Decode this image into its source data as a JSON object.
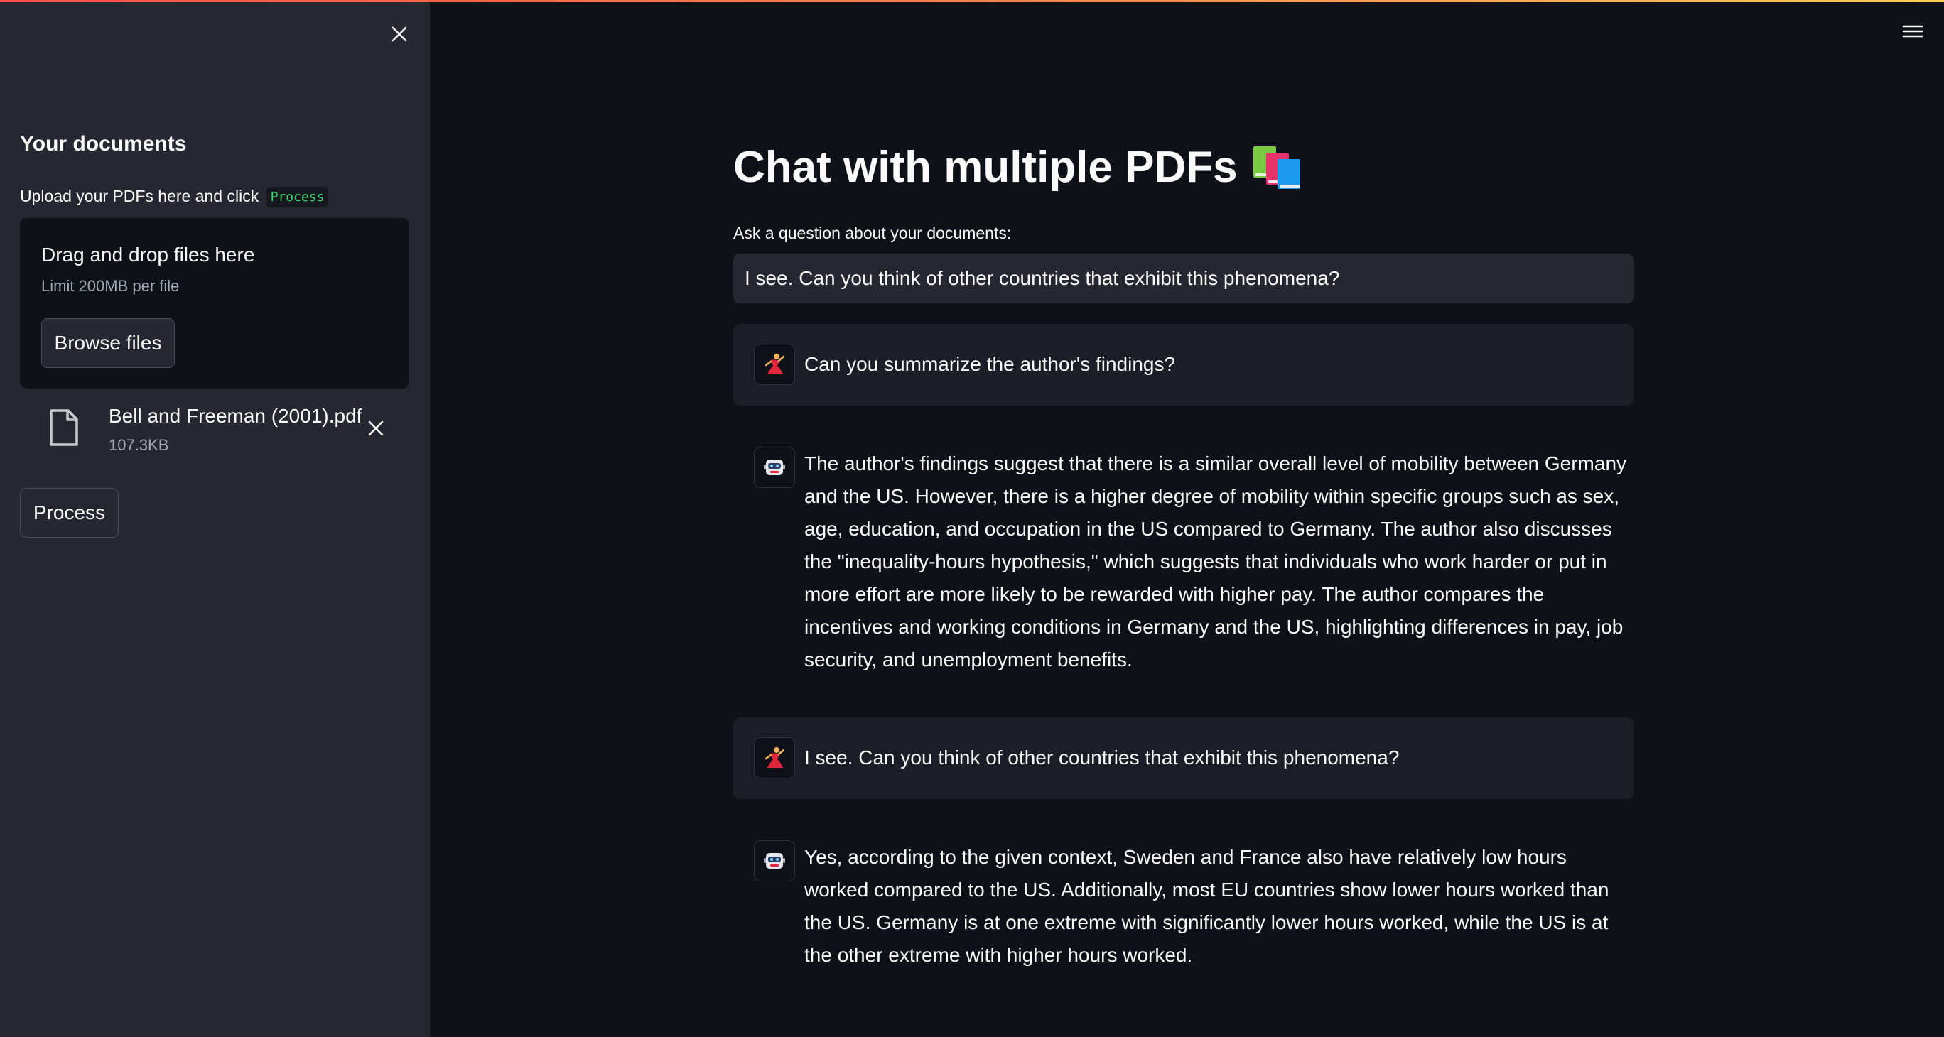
{
  "sidebar": {
    "title": "Your documents",
    "instruction": "Upload your PDFs here and click",
    "instruction_code": "Process",
    "dropzone": {
      "title": "Drag and drop files here",
      "limit": "Limit 200MB per file",
      "browse_label": "Browse files"
    },
    "file": {
      "name": "Bell and Freeman (2001).pdf",
      "size": "107.3KB"
    },
    "process_label": "Process"
  },
  "main": {
    "title": "Chat with multiple PDFs",
    "title_emoji_icon": "books-icon",
    "question_label": "Ask a question about your documents:",
    "question_value": "I see. Can you think of other countries that exhibit this phenomena?",
    "messages": [
      {
        "role": "user",
        "text": "Can you summarize the author's findings?"
      },
      {
        "role": "bot",
        "text": "The author's findings suggest that there is a similar overall level of mobility between Germany and the US. However, there is a higher degree of mobility within specific groups such as sex, age, education, and occupation in the US compared to Germany. The author also discusses the \"inequality-hours hypothesis,\" which suggests that individuals who work harder or put in more effort are more likely to be rewarded with higher pay. The author compares the incentives and working conditions in Germany and the US, highlighting differences in pay, job security, and unemployment benefits."
      },
      {
        "role": "user",
        "text": "I see. Can you think of other countries that exhibit this phenomena?"
      },
      {
        "role": "bot",
        "text": "Yes, according to the given context, Sweden and France also have relatively low hours worked compared to the US. Additionally, most EU countries show lower hours worked than the US. Germany is at one extreme with significantly lower hours worked, while the US is at the other extreme with higher hours worked."
      }
    ]
  },
  "colors": {
    "background": "#0e1117",
    "sidebar": "#262730",
    "user_message_bg": "#1b1e27",
    "code_text": "#3dd56d",
    "accent": "#ff4b4b"
  }
}
